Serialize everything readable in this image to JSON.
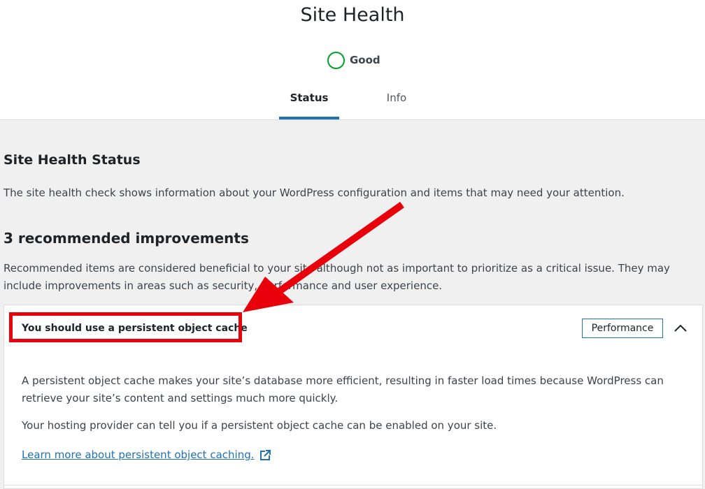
{
  "page": {
    "title": "Site Health",
    "status_label": "Good",
    "status_color": "#00a32a"
  },
  "tabs": [
    {
      "label": "Status",
      "active": true
    },
    {
      "label": "Info",
      "active": false
    }
  ],
  "status_section": {
    "title": "Site Health Status",
    "description": "The site health check shows information about your WordPress configuration and items that may need your attention."
  },
  "improvements": {
    "count_label": "3 recommended improvements",
    "description": "Recommended items are considered beneficial to your site although not as important to prioritize as a critical issue. They may include improvements in areas such as security, performance and user experience."
  },
  "issue": {
    "title": "You should use a persistent object cache",
    "badge": "Performance",
    "expanded": true,
    "paragraph_1": "A persistent object cache makes your site’s database more efficient, resulting in faster load times because WordPress can retrieve your site’s content and settings much more quickly.",
    "paragraph_2": "Your hosting provider can tell you if a persistent object cache can be enabled on your site.",
    "link_text": "Learn more about persistent object caching."
  },
  "colors": {
    "accent": "#2271b1",
    "annotation": "#e8000b",
    "good": "#00a32a"
  },
  "icons": {
    "status": "status-circle-icon",
    "collapse": "chevron-up-icon",
    "external": "external-link-icon"
  }
}
